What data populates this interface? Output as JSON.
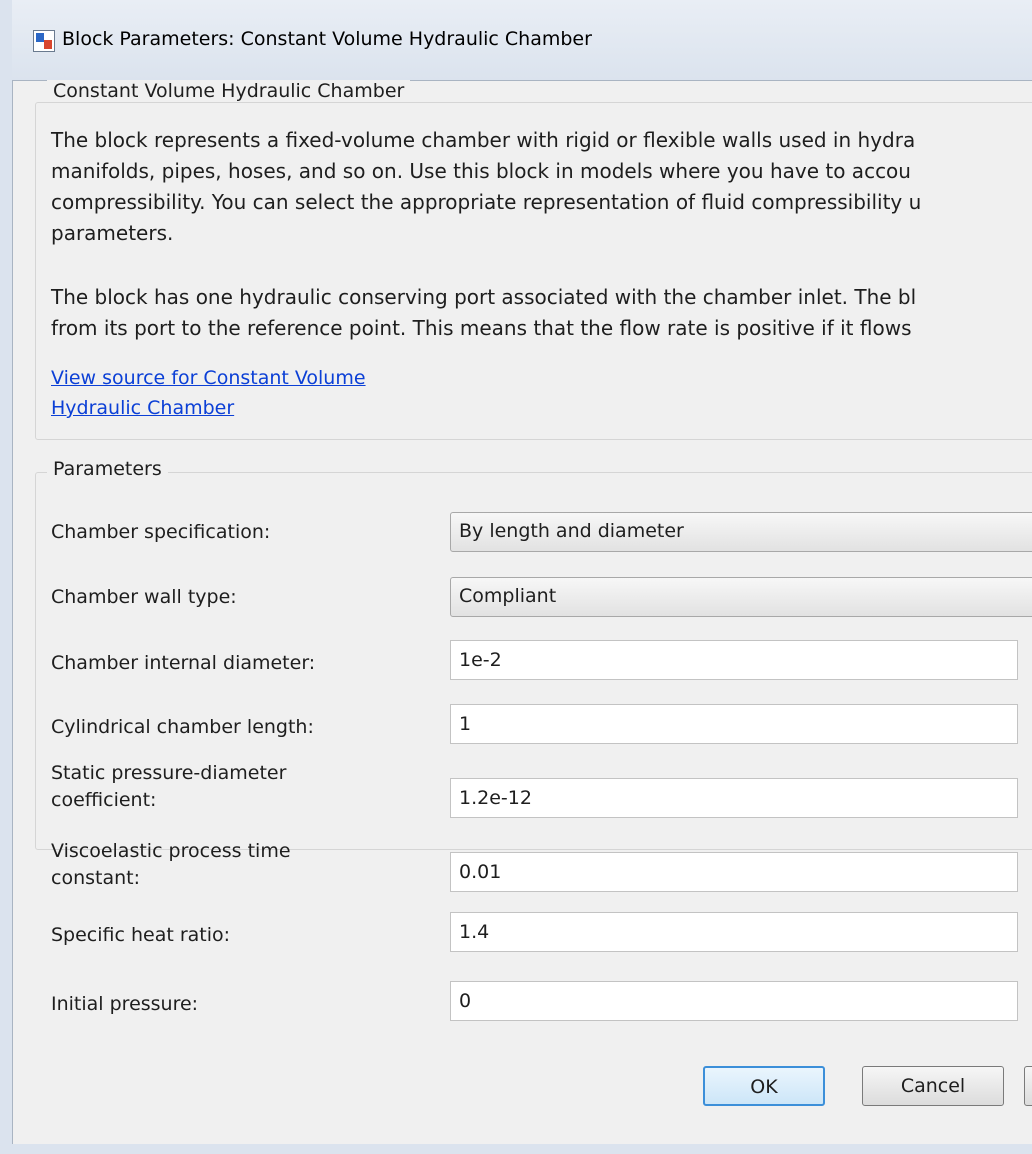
{
  "window": {
    "title": "Block Parameters: Constant Volume Hydraulic Chamber"
  },
  "description_group": {
    "legend": "Constant Volume Hydraulic Chamber",
    "lines": [
      "The block represents a fixed-volume chamber with rigid or flexible walls used in hydra",
      "manifolds, pipes, hoses, and so on. Use this block in models where you have to accou",
      "compressibility. You can select the appropriate representation of fluid compressibility u",
      "parameters.",
      "The block has one hydraulic conserving port associated with the chamber inlet. The bl",
      "from its port to the reference point. This means that the flow rate is positive if it flows"
    ],
    "link_lines": [
      "View source for Constant Volume",
      "Hydraulic Chamber"
    ]
  },
  "parameters_group": {
    "legend": "Parameters",
    "fields": [
      {
        "label": "Chamber specification:",
        "type": "dropdown",
        "value": "By length and diameter"
      },
      {
        "label": "Chamber wall type:",
        "type": "dropdown",
        "value": "Compliant"
      },
      {
        "label": "Chamber internal diameter:",
        "type": "text",
        "value": "1e-2"
      },
      {
        "label": "Cylindrical chamber length:",
        "type": "text",
        "value": "1"
      },
      {
        "label_lines": [
          "Static pressure-diameter",
          "coefficient:"
        ],
        "type": "text",
        "value": "1.2e-12"
      },
      {
        "label_lines": [
          "Viscoelastic process time",
          "constant:"
        ],
        "type": "text",
        "value": "0.01"
      },
      {
        "label": "Specific heat ratio:",
        "type": "text",
        "value": "1.4"
      },
      {
        "label": "Initial pressure:",
        "type": "text",
        "value": "0"
      }
    ]
  },
  "buttons": {
    "ok": "OK",
    "cancel": "Cancel"
  }
}
